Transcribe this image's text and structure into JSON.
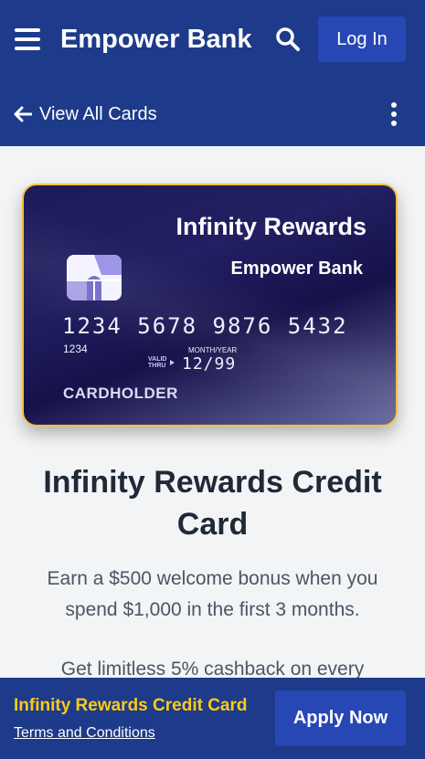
{
  "header": {
    "menu_icon": "hamburger-menu-icon",
    "brand": "Empower Bank",
    "search_icon": "search-icon",
    "login_label": "Log In",
    "back_label": "View All Cards",
    "back_icon": "arrow-left-icon",
    "more_icon": "vertical-ellipsis-icon"
  },
  "card": {
    "product_name": "Infinity Rewards",
    "bank_name": "Empower Bank",
    "number": "1234 5678 9876 5432",
    "number_small": "1234",
    "valid_label_1": "VALID",
    "valid_label_2": "THRU",
    "month_year_label": "MONTH/YEAR",
    "expiry": "12/99",
    "holder": "CARDHOLDER",
    "border_color": "#f0c23a"
  },
  "main": {
    "title": "Infinity Rewards Credit Card",
    "description": "Earn a $500 welcome bonus when you spend $1,000 in the first 3 months.",
    "description_2": "Get limitless 5% cashback on every"
  },
  "footer": {
    "title": "Infinity Rewards Credit Card",
    "terms_label": "Terms and Conditions",
    "apply_label": "Apply Now"
  },
  "colors": {
    "primary": "#1e3a8a",
    "button": "#2747b5",
    "accent": "#facc15",
    "background": "#f3f4f6"
  }
}
